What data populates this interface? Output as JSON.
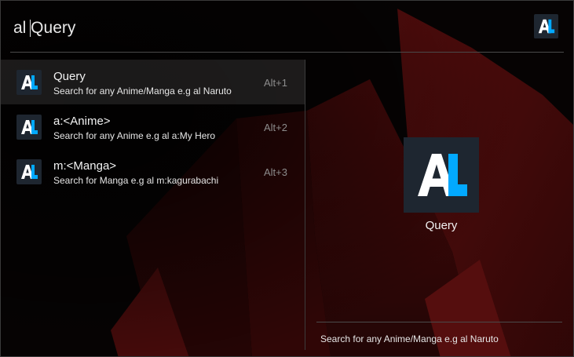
{
  "search": {
    "action_keyword": "al",
    "query": "Query"
  },
  "plugin": {
    "icon": "anilist-icon",
    "colors": {
      "tile": "#1e2630",
      "letter": "#ffffff",
      "accent": "#02a9ff"
    }
  },
  "results": [
    {
      "title": "Query",
      "subtitle": "Search for any Anime/Manga e.g al Naruto",
      "hotkey": "Alt+1",
      "selected": true
    },
    {
      "title": "a:<Anime>",
      "subtitle": "Search for any Anime e.g al a:My Hero",
      "hotkey": "Alt+2",
      "selected": false
    },
    {
      "title": "m:<Manga>",
      "subtitle": "Search for Manga e.g al m:kagurabachi",
      "hotkey": "Alt+3",
      "selected": false
    }
  ],
  "preview": {
    "title": "Query",
    "subtitle": "Search for any Anime/Manga e.g al Naruto"
  }
}
